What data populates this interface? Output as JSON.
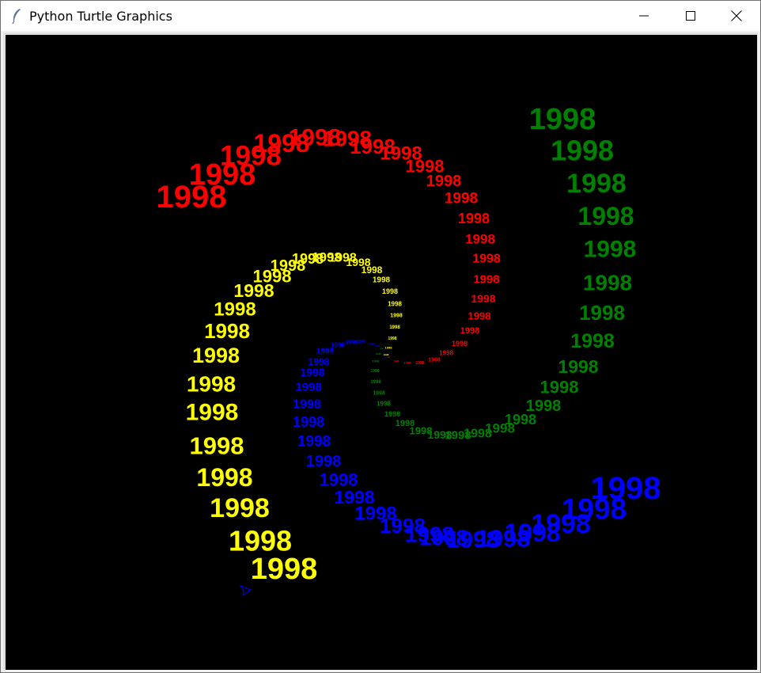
{
  "window": {
    "title": "Python Turtle Graphics",
    "icon": "feather-icon",
    "controls": [
      "minimize-icon",
      "maximize-icon",
      "close-icon"
    ]
  },
  "canvas": {
    "background": "#000000",
    "label_text": "1998",
    "colors": {
      "red": "#ff0000",
      "yellow": "#ffff00",
      "blue": "#0000ff",
      "green": "#008000"
    },
    "turtle": {
      "icon": "turtle-arrow-icon",
      "color": "#0000ff"
    }
  }
}
